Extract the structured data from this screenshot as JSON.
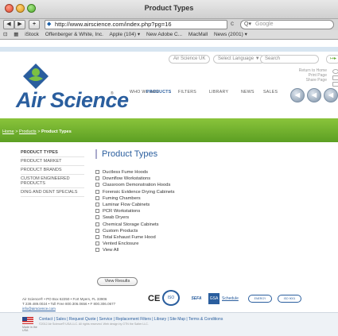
{
  "window": {
    "title": "Product Types"
  },
  "browser": {
    "url": "http://www.airscience.com/index.php?pg=16",
    "search_placeholder": "Google",
    "nav_back": "◀",
    "nav_forward": "▶",
    "add_label": "+",
    "reload": "c",
    "bookmarks": [
      "iStock",
      "Offenberger & White, Inc.",
      "Apple (104) ▾",
      "New Adobe C...",
      "MacMall",
      "News (2001) ▾"
    ]
  },
  "header": {
    "logo_text": "Air Science",
    "logo_tm": "®",
    "region_select": "Air Science UK",
    "language_select": "Select Language ▼",
    "search_label": "Search",
    "rss_label": "↦▸",
    "utility_links": [
      "Return to Home",
      "Print Page",
      "Share Page"
    ],
    "nav": [
      "WHO WE ARE",
      "PRODUCTS",
      "FILTERS",
      "LIBRARY",
      "NEWS",
      "SALES"
    ],
    "circle_icons": [
      "◀",
      "◀",
      "◀"
    ]
  },
  "breadcrumb": {
    "home": "Home",
    "sep1": " > ",
    "products": "Products",
    "sep2": " > ",
    "current": "Product Types"
  },
  "sidebar": {
    "items": [
      "PRODUCT TYPES",
      "PRODUCT MARKET",
      "PRODUCT BRANDS",
      "CUSTOM ENGINEERED PRODUCTS",
      "DING AND DENT SPECIALS"
    ]
  },
  "main": {
    "title": "Product Types",
    "options": [
      "Ductless Fume Hoods",
      "Downflow Workstations",
      "Classroom Demonstration Hoods",
      "Forensic Evidence Drying Cabinets",
      "Fuming Chambers",
      "Laminar Flow Cabinets",
      "PCR Workstations",
      "Swab Dryers",
      "Chemical Storage Cabinets",
      "Custom Products",
      "Total Exhaust Fume Hood",
      "Vented Enclosure",
      "View All"
    ],
    "view_button": "View Results"
  },
  "footer": {
    "address_line1": "Air Science® • PO Box 62250 • Fort Myers, FL 33906",
    "address_line2": "T 239.489.0024 • Toll Free 800.306.0656 • F 800.306.0677",
    "email": "info@airscience.com",
    "badges": [
      "CE",
      "ISO",
      "SEFA",
      "GSA",
      "Schedule",
      "ENERGY",
      "ISO 9001"
    ],
    "links": "Contact | Sales | Request Quote | Service | Replacement Filters | Library | Site Map | Terms & Conditions",
    "copyright": "©2012 Air Science® USA LLC. All rights reserved. Web design by GTN the Salter LLC.",
    "made_in": "Made in the USA"
  },
  "colors": {
    "brand_blue": "#2a5e9e",
    "green_bar": "#6aab2a"
  }
}
